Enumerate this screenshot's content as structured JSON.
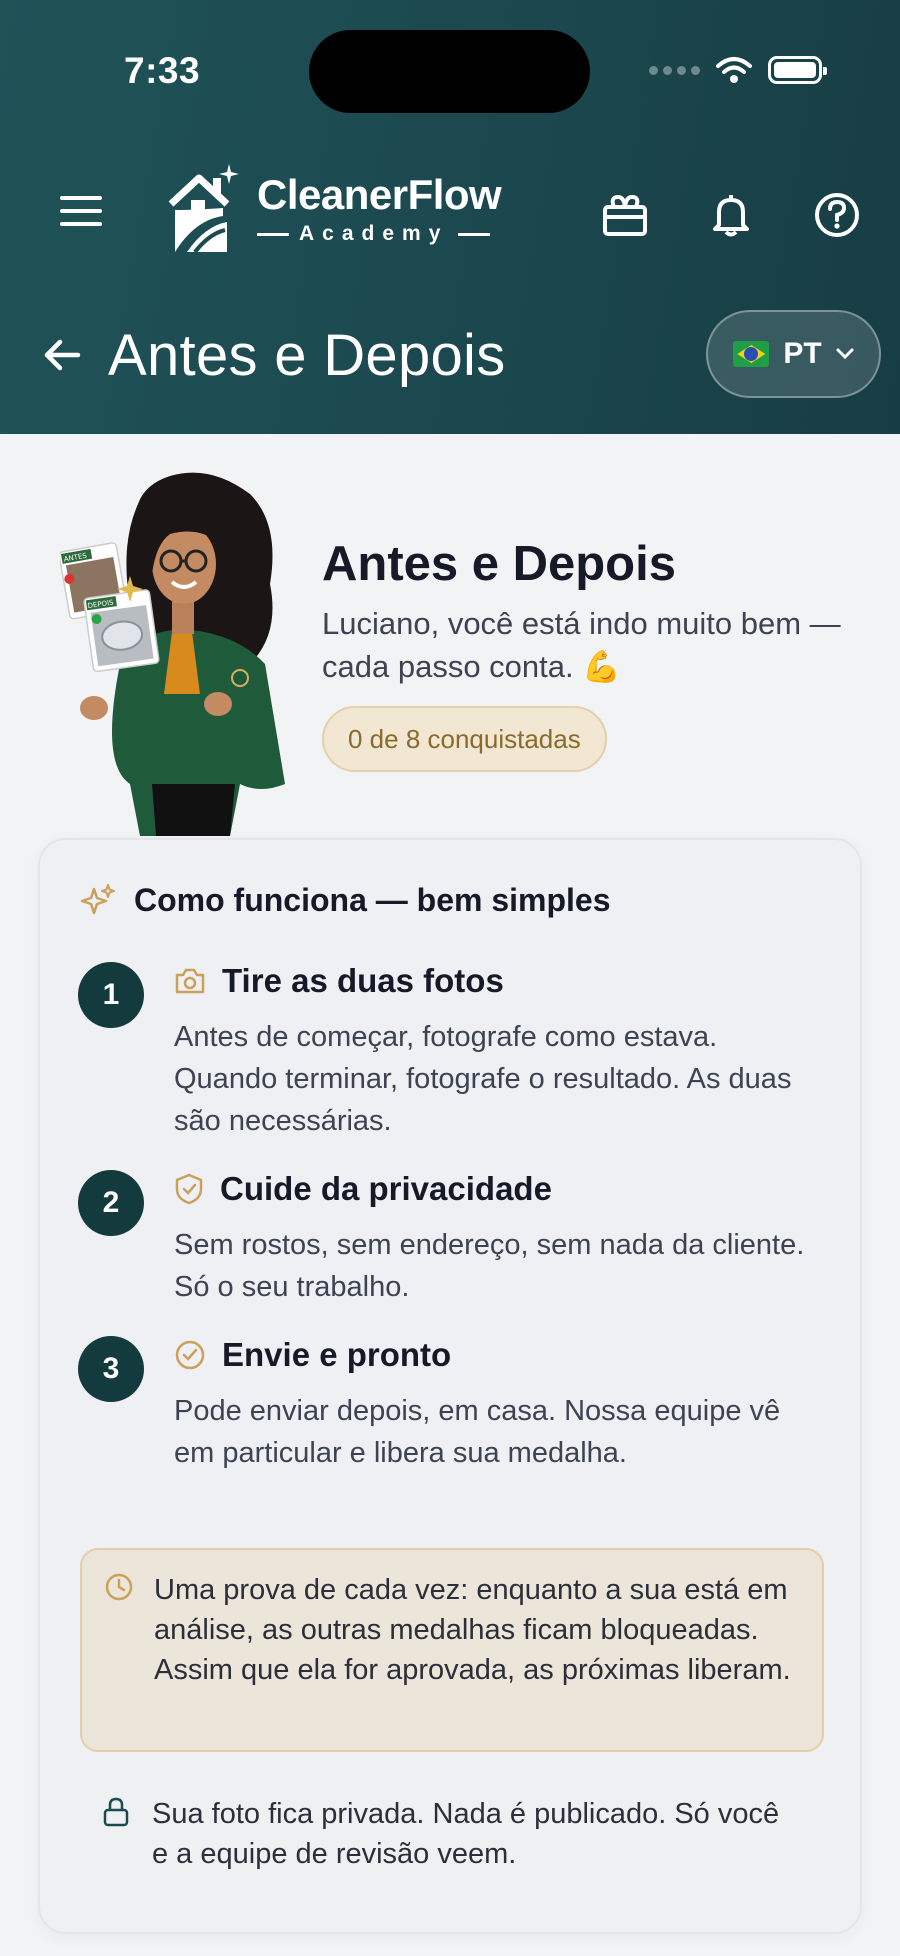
{
  "status_bar": {
    "time": "7:33"
  },
  "brand": {
    "title": "CleanerFlow",
    "subtitle": "Academy"
  },
  "header": {
    "page_title": "Antes e Depois",
    "language": "PT"
  },
  "hero": {
    "title": "Antes e Depois",
    "message": "Luciano, você está indo muito bem — cada passo conta. 💪",
    "progress": "0 de 8 conquistadas",
    "card_labels": {
      "before": "ANTES",
      "after": "DEPOIS"
    }
  },
  "how_it_works": {
    "title": "Como funciona — bem simples",
    "steps": [
      {
        "number": "1",
        "icon": "camera-icon",
        "title": "Tire as duas fotos",
        "description": "Antes de começar, fotografe como estava. Quando terminar, fotografe o resultado. As duas são necessárias."
      },
      {
        "number": "2",
        "icon": "shield-icon",
        "title": "Cuide da privacidade",
        "description": "Sem rostos, sem endereço, sem nada da cliente. Só o seu trabalho."
      },
      {
        "number": "3",
        "icon": "check-circle-icon",
        "title": "Envie e pronto",
        "description": "Pode enviar depois, em casa. Nossa equipe vê em particular e libera sua medalha."
      }
    ],
    "review_note": "Uma prova de cada vez: enquanto a sua está em análise, as outras medalhas ficam bloqueadas. Assim que ela for aprovada, as próximas liberam.",
    "privacy_note": "Sua foto fica privada. Nada é publicado. Só você e a equipe de revisão veem."
  },
  "colors": {
    "header_bg": "#1c4a50",
    "accent_gold": "#c9a15a",
    "step_badge": "#133a3d",
    "page_bg": "#f2f3f4"
  }
}
